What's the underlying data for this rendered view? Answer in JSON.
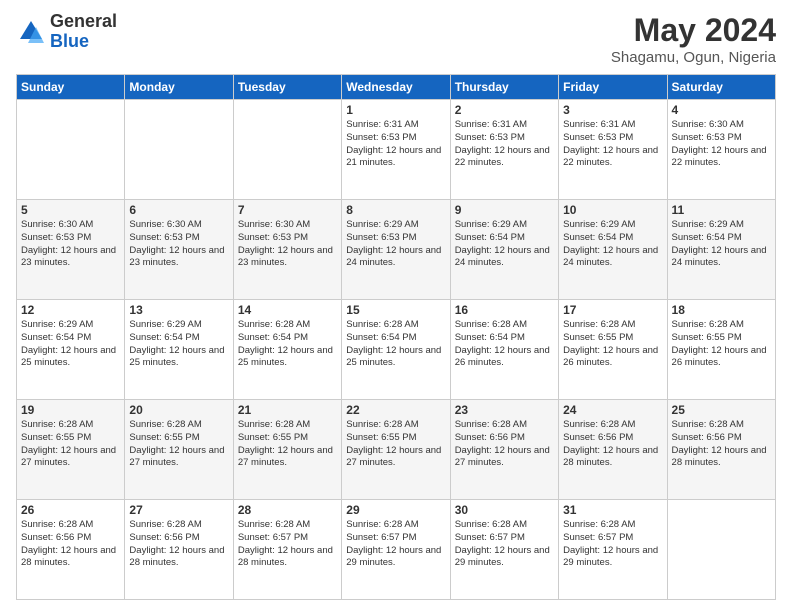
{
  "header": {
    "logo_general": "General",
    "logo_blue": "Blue",
    "month_year": "May 2024",
    "location": "Shagamu, Ogun, Nigeria"
  },
  "days_of_week": [
    "Sunday",
    "Monday",
    "Tuesday",
    "Wednesday",
    "Thursday",
    "Friday",
    "Saturday"
  ],
  "weeks": [
    [
      {
        "day": "",
        "info": ""
      },
      {
        "day": "",
        "info": ""
      },
      {
        "day": "",
        "info": ""
      },
      {
        "day": "1",
        "info": "Sunrise: 6:31 AM\nSunset: 6:53 PM\nDaylight: 12 hours and 21 minutes."
      },
      {
        "day": "2",
        "info": "Sunrise: 6:31 AM\nSunset: 6:53 PM\nDaylight: 12 hours and 22 minutes."
      },
      {
        "day": "3",
        "info": "Sunrise: 6:31 AM\nSunset: 6:53 PM\nDaylight: 12 hours and 22 minutes."
      },
      {
        "day": "4",
        "info": "Sunrise: 6:30 AM\nSunset: 6:53 PM\nDaylight: 12 hours and 22 minutes."
      }
    ],
    [
      {
        "day": "5",
        "info": "Sunrise: 6:30 AM\nSunset: 6:53 PM\nDaylight: 12 hours and 23 minutes."
      },
      {
        "day": "6",
        "info": "Sunrise: 6:30 AM\nSunset: 6:53 PM\nDaylight: 12 hours and 23 minutes."
      },
      {
        "day": "7",
        "info": "Sunrise: 6:30 AM\nSunset: 6:53 PM\nDaylight: 12 hours and 23 minutes."
      },
      {
        "day": "8",
        "info": "Sunrise: 6:29 AM\nSunset: 6:53 PM\nDaylight: 12 hours and 24 minutes."
      },
      {
        "day": "9",
        "info": "Sunrise: 6:29 AM\nSunset: 6:54 PM\nDaylight: 12 hours and 24 minutes."
      },
      {
        "day": "10",
        "info": "Sunrise: 6:29 AM\nSunset: 6:54 PM\nDaylight: 12 hours and 24 minutes."
      },
      {
        "day": "11",
        "info": "Sunrise: 6:29 AM\nSunset: 6:54 PM\nDaylight: 12 hours and 24 minutes."
      }
    ],
    [
      {
        "day": "12",
        "info": "Sunrise: 6:29 AM\nSunset: 6:54 PM\nDaylight: 12 hours and 25 minutes."
      },
      {
        "day": "13",
        "info": "Sunrise: 6:29 AM\nSunset: 6:54 PM\nDaylight: 12 hours and 25 minutes."
      },
      {
        "day": "14",
        "info": "Sunrise: 6:28 AM\nSunset: 6:54 PM\nDaylight: 12 hours and 25 minutes."
      },
      {
        "day": "15",
        "info": "Sunrise: 6:28 AM\nSunset: 6:54 PM\nDaylight: 12 hours and 25 minutes."
      },
      {
        "day": "16",
        "info": "Sunrise: 6:28 AM\nSunset: 6:54 PM\nDaylight: 12 hours and 26 minutes."
      },
      {
        "day": "17",
        "info": "Sunrise: 6:28 AM\nSunset: 6:55 PM\nDaylight: 12 hours and 26 minutes."
      },
      {
        "day": "18",
        "info": "Sunrise: 6:28 AM\nSunset: 6:55 PM\nDaylight: 12 hours and 26 minutes."
      }
    ],
    [
      {
        "day": "19",
        "info": "Sunrise: 6:28 AM\nSunset: 6:55 PM\nDaylight: 12 hours and 27 minutes."
      },
      {
        "day": "20",
        "info": "Sunrise: 6:28 AM\nSunset: 6:55 PM\nDaylight: 12 hours and 27 minutes."
      },
      {
        "day": "21",
        "info": "Sunrise: 6:28 AM\nSunset: 6:55 PM\nDaylight: 12 hours and 27 minutes."
      },
      {
        "day": "22",
        "info": "Sunrise: 6:28 AM\nSunset: 6:55 PM\nDaylight: 12 hours and 27 minutes."
      },
      {
        "day": "23",
        "info": "Sunrise: 6:28 AM\nSunset: 6:56 PM\nDaylight: 12 hours and 27 minutes."
      },
      {
        "day": "24",
        "info": "Sunrise: 6:28 AM\nSunset: 6:56 PM\nDaylight: 12 hours and 28 minutes."
      },
      {
        "day": "25",
        "info": "Sunrise: 6:28 AM\nSunset: 6:56 PM\nDaylight: 12 hours and 28 minutes."
      }
    ],
    [
      {
        "day": "26",
        "info": "Sunrise: 6:28 AM\nSunset: 6:56 PM\nDaylight: 12 hours and 28 minutes."
      },
      {
        "day": "27",
        "info": "Sunrise: 6:28 AM\nSunset: 6:56 PM\nDaylight: 12 hours and 28 minutes."
      },
      {
        "day": "28",
        "info": "Sunrise: 6:28 AM\nSunset: 6:57 PM\nDaylight: 12 hours and 28 minutes."
      },
      {
        "day": "29",
        "info": "Sunrise: 6:28 AM\nSunset: 6:57 PM\nDaylight: 12 hours and 29 minutes."
      },
      {
        "day": "30",
        "info": "Sunrise: 6:28 AM\nSunset: 6:57 PM\nDaylight: 12 hours and 29 minutes."
      },
      {
        "day": "31",
        "info": "Sunrise: 6:28 AM\nSunset: 6:57 PM\nDaylight: 12 hours and 29 minutes."
      },
      {
        "day": "",
        "info": ""
      }
    ]
  ]
}
